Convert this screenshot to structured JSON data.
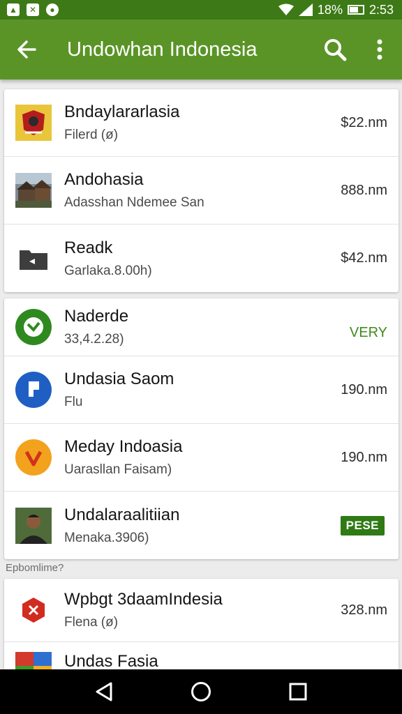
{
  "status_bar": {
    "battery_text": "18%",
    "time": "2:53",
    "icons": [
      "image-icon",
      "sim-icon",
      "circle-notification-icon",
      "wifi-icon",
      "signal-icon",
      "battery-icon"
    ]
  },
  "app_bar": {
    "title": "Undowhan Indonesia",
    "back_icon": "arrow-back-icon",
    "search_icon": "search-icon",
    "menu_icon": "more-vert-icon"
  },
  "colors": {
    "status_bar": "#3d7a17",
    "app_bar": "#5a9427",
    "accent_green": "#2f7a14",
    "value_green": "#3f8a1b"
  },
  "card1": {
    "items": [
      {
        "title": "Bndaylararlasia",
        "subtitle": "Filerd (ø)",
        "value": "$22.nm",
        "thumb": "emblem-icon"
      },
      {
        "title": "Andohasia",
        "subtitle": "Adasshan Ndemee San",
        "value": "888.nm",
        "thumb": "village-photo"
      },
      {
        "title": "Readk",
        "subtitle": "Garlaka.8.00h)",
        "value": "$42.nm",
        "thumb": "folder-icon"
      }
    ]
  },
  "card2": {
    "items": [
      {
        "title": "Naderde",
        "subtitle": "33,4.2.28)",
        "value": "VERY",
        "thumb": "green-logo-icon"
      },
      {
        "title": "Undasia Saom",
        "subtitle": "Flu",
        "value": "190.nm",
        "thumb": "blue-logo-icon"
      },
      {
        "title": "Meday Indoasia",
        "subtitle": "Uarasllan Faisam)",
        "value": "190.nm",
        "thumb": "orange-logo-icon"
      },
      {
        "title": "Undalaraalitiian",
        "subtitle": "Menaka.3906)",
        "badge": "PESE",
        "thumb": "person-photo"
      }
    ]
  },
  "section": {
    "label": "Epbomlime?"
  },
  "card3": {
    "items": [
      {
        "title": "Wpbgt 3daamIndesia",
        "subtitle": "Flena (ø)",
        "value": "328.nm",
        "thumb": "red-hex-icon"
      },
      {
        "title": "Undas Fasia",
        "value": "",
        "thumb": "colorful-icon"
      }
    ]
  },
  "nav_bar": {
    "icons": [
      "back-triangle-icon",
      "home-circle-icon",
      "recents-square-icon"
    ]
  }
}
